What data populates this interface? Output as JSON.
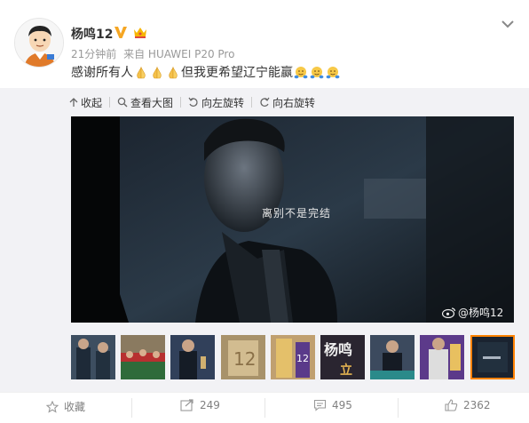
{
  "user": {
    "name": "杨鸣12"
  },
  "post": {
    "time": "21分钟前",
    "source": "来自 HUAWEI P20 Pro",
    "text_before": "感谢所有人",
    "text_mid": "但我更希望辽宁能赢",
    "emoji_praying": [
      "praying-hands-emoji",
      "praying-hands-emoji",
      "praying-hands-emoji"
    ],
    "emoji_hug": [
      "hug-emoji",
      "hug-emoji",
      "hug-emoji"
    ]
  },
  "toolbar": {
    "collapse": "收起",
    "view_large": "查看大图",
    "rotate_left": "向左旋转",
    "rotate_right": "向右旋转"
  },
  "image": {
    "caption": "离别不是完结",
    "watermark": "@杨鸣12"
  },
  "thumbnails": [
    {
      "id": "thumb-1",
      "active": false
    },
    {
      "id": "thumb-2",
      "active": false
    },
    {
      "id": "thumb-3",
      "active": false
    },
    {
      "id": "thumb-4",
      "active": false
    },
    {
      "id": "thumb-5",
      "active": false
    },
    {
      "id": "thumb-6",
      "active": false
    },
    {
      "id": "thumb-7",
      "active": false
    },
    {
      "id": "thumb-8",
      "active": false
    },
    {
      "id": "thumb-9",
      "active": true
    }
  ],
  "actions": {
    "favorite": "收藏",
    "repost": "249",
    "comment": "495",
    "like": "2362"
  },
  "colors": {
    "accent": "#ff8200",
    "muted": "#808080",
    "gallery_bg": "#f2f2f5"
  }
}
